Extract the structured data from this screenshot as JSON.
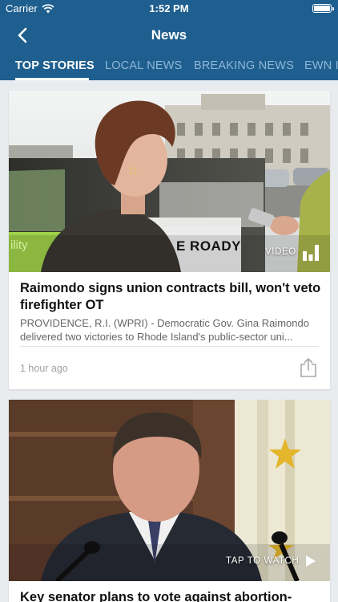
{
  "status_bar": {
    "carrier": "Carrier",
    "time": "1:52 PM"
  },
  "nav": {
    "title": "News"
  },
  "tabs": [
    {
      "label": "TOP STORIES",
      "active": true
    },
    {
      "label": "LOCAL NEWS",
      "active": false
    },
    {
      "label": "BREAKING NEWS",
      "active": false
    },
    {
      "label": "EWN IN",
      "active": false
    }
  ],
  "articles": [
    {
      "title": "Raimondo signs union contracts bill, won't veto firefighter OT",
      "summary_line1": "PROVIDENCE, R.I. (WPRI) - Democratic Gov. Gina Raimondo",
      "summary_line2": "delivered two victories to Rhode Island's public-sector uni...",
      "time": "1 hour ago",
      "media_label": "VIDEO",
      "vehicle_text": "E ROADY",
      "side_text": "ility"
    },
    {
      "title": "Key senator plans to vote against abortion-",
      "media_label": "TAP TO WATCH"
    }
  ],
  "colors": {
    "header": "#1f5f8f",
    "tab_inactive": "#8fb6d6",
    "background": "#e9ecef"
  }
}
